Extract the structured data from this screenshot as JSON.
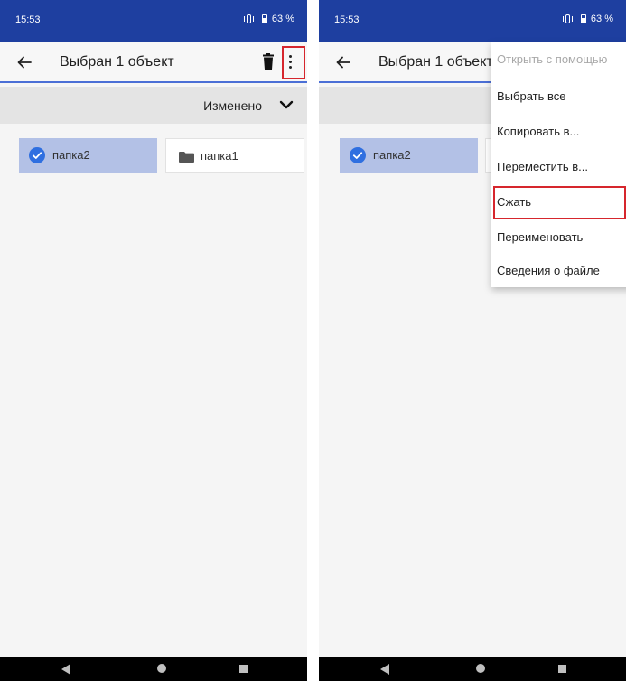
{
  "colors": {
    "status_bar": "#1e3fa0",
    "app_bar": "#f7f7f7",
    "accent_line": "#4b6fd6",
    "sort_bar": "#e4e4e4",
    "selected_tile": "#b3c1e6",
    "check_fill": "#2f6fe0",
    "highlight_red": "#d6262d"
  },
  "left": {
    "status": {
      "time": "15:53",
      "battery": "63 %"
    },
    "appbar": {
      "title": "Выбран 1 объект"
    },
    "sort": {
      "label": "Изменено"
    },
    "files": [
      {
        "name": "папка2",
        "selected": true
      },
      {
        "name": "папка1",
        "selected": false
      }
    ]
  },
  "right": {
    "status": {
      "time": "15:53",
      "battery": "63 %"
    },
    "appbar": {
      "title": "Выбран 1 объект"
    },
    "files": [
      {
        "name": "папка2",
        "selected": true
      }
    ],
    "menu": {
      "items": [
        {
          "label": "Открыть с помощью",
          "enabled": false
        },
        {
          "label": "Выбрать все",
          "enabled": true
        },
        {
          "label": "Копировать в...",
          "enabled": true
        },
        {
          "label": "Переместить в...",
          "enabled": true
        },
        {
          "label": "Сжать",
          "enabled": true,
          "highlighted": true
        },
        {
          "label": "Переименовать",
          "enabled": true
        },
        {
          "label": "Сведения о файле",
          "enabled": true
        }
      ]
    }
  }
}
